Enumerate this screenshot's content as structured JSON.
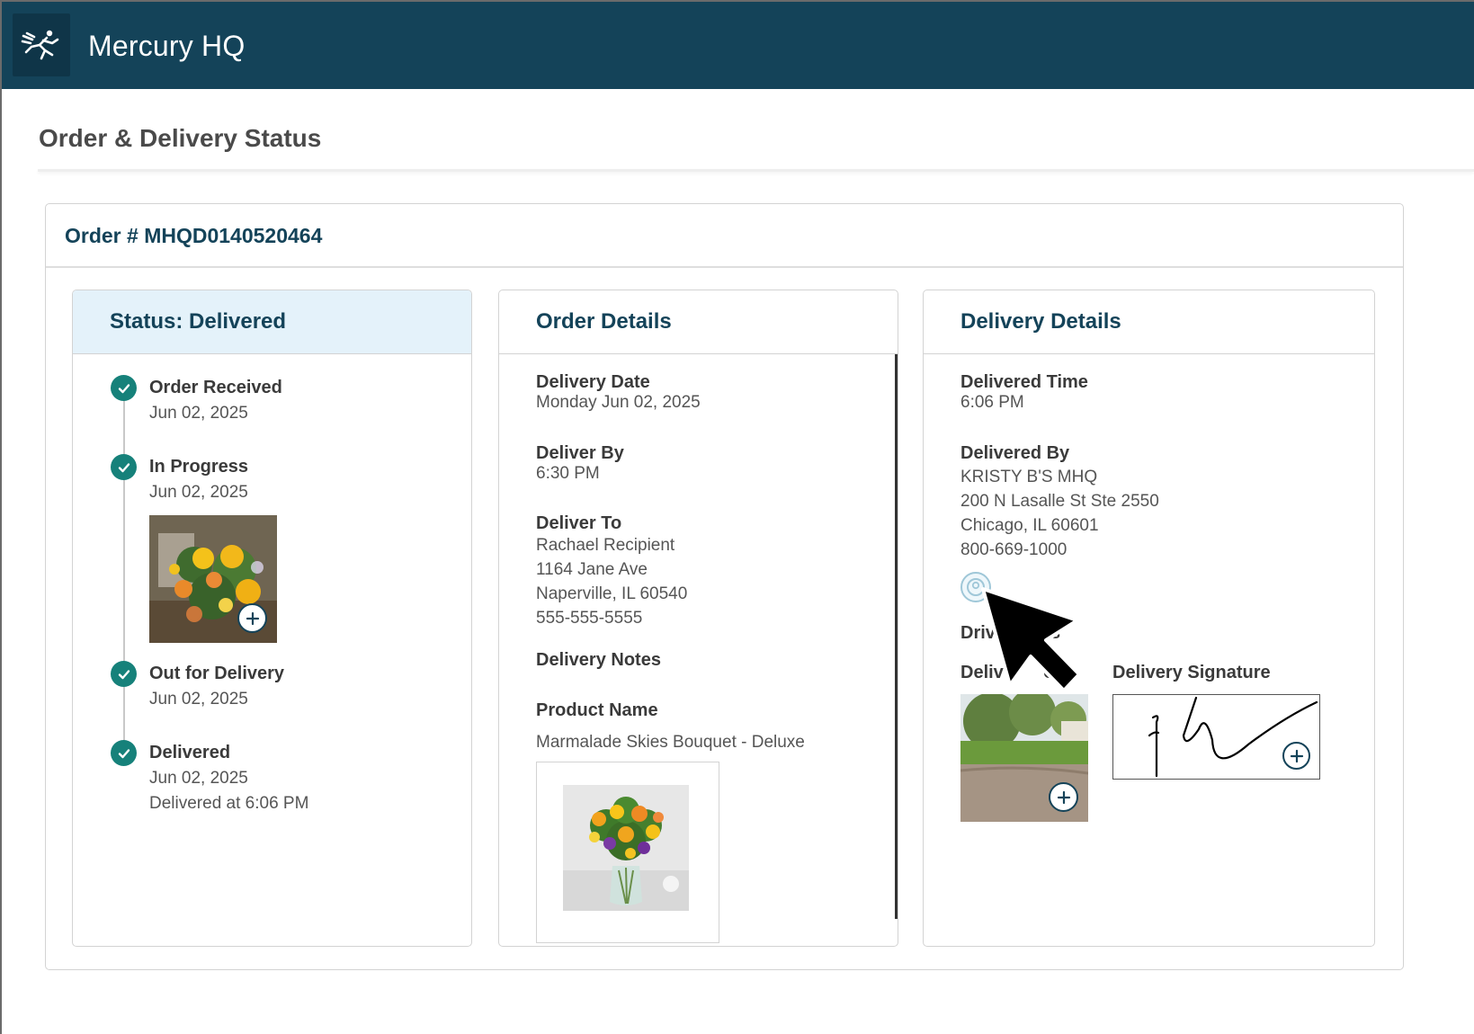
{
  "app": {
    "title": "Mercury HQ",
    "logo_icon": "mercury-runner-icon"
  },
  "page": {
    "title": "Order & Delivery Status"
  },
  "order": {
    "number_label": "Order # MHQD0140520464"
  },
  "status_panel": {
    "title": "Status: Delivered",
    "steps": [
      {
        "label": "Order Received",
        "date": "Jun 02, 2025"
      },
      {
        "label": "In Progress",
        "date": "Jun 02, 2025"
      },
      {
        "label": "Out for Delivery",
        "date": "Jun 02, 2025"
      },
      {
        "label": "Delivered",
        "date": "Jun 02, 2025",
        "note": "Delivered at 6:06 PM"
      }
    ]
  },
  "order_details": {
    "title": "Order Details",
    "delivery_date_label": "Delivery Date",
    "delivery_date": "Monday Jun 02, 2025",
    "deliver_by_label": "Deliver By",
    "deliver_by": "6:30 PM",
    "deliver_to_label": "Deliver To",
    "recipient_name": "Rachael Recipient",
    "recipient_street": "1164 Jane Ave",
    "recipient_city": "Naperville, IL 60540",
    "recipient_phone": "555-555-5555",
    "delivery_notes_label": "Delivery Notes",
    "product_name_label": "Product Name",
    "product_name": "Marmalade Skies Bouquet - Deluxe"
  },
  "delivery_details": {
    "title": "Delivery Details",
    "delivered_time_label": "Delivered Time",
    "delivered_time": "6:06 PM",
    "delivered_by_label": "Delivered By",
    "shop_name": "KRISTY B'S MHQ",
    "shop_street": "200 N Lasalle St Ste 2550",
    "shop_city": "Chicago, IL 60601",
    "shop_phone": "800-669-1000",
    "driver_notes_label": "Driv         es",
    "delivery_photo_label": "Deliv        o",
    "delivery_signature_label": "Delivery Signature"
  },
  "colors": {
    "header_bg": "#144359",
    "accent": "#144359",
    "check": "#16817a",
    "status_header_bg": "#e4f2fa"
  }
}
